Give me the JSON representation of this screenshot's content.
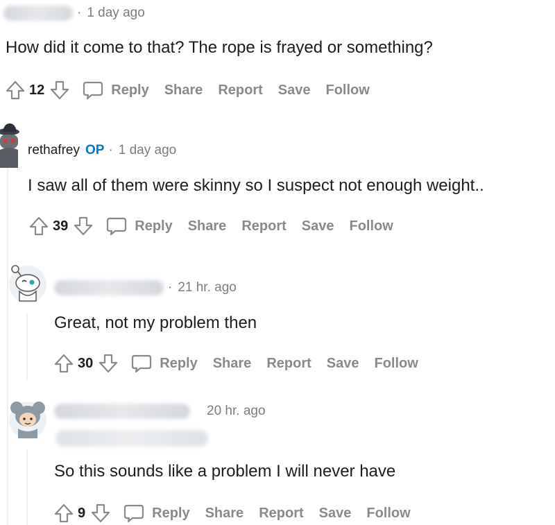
{
  "comments": [
    {
      "username_visible": false,
      "time": "1 day ago",
      "body": "How did it come to that? The rope is frayed or something?",
      "votes": "12",
      "actions": [
        "Reply",
        "Share",
        "Report",
        "Save",
        "Follow"
      ]
    },
    {
      "username": "rethafrey",
      "op_label": "OP",
      "time": "1 day ago",
      "body": "I saw all of them were skinny so I suspect not enough weight..",
      "votes": "39",
      "actions": [
        "Reply",
        "Share",
        "Report",
        "Save",
        "Follow"
      ]
    },
    {
      "username_visible": false,
      "time": "21 hr. ago",
      "body": "Great, not my problem then",
      "votes": "30",
      "actions": [
        "Reply",
        "Share",
        "Report",
        "Save",
        "Follow"
      ]
    },
    {
      "username_visible": false,
      "time": "20 hr. ago",
      "body": "So this sounds like a problem I will never have",
      "votes": "9",
      "actions": [
        "Reply",
        "Share",
        "Report",
        "Save",
        "Follow"
      ]
    }
  ],
  "separator": "·",
  "icons": {
    "upvote": "upvote-arrow-icon",
    "downvote": "downvote-arrow-icon",
    "reply": "speech-bubble-icon"
  },
  "colors": {
    "op": "#0079d3",
    "action_text": "#878a8c",
    "body_text": "#1c1c1c",
    "meta_text": "#7c7c7c"
  }
}
